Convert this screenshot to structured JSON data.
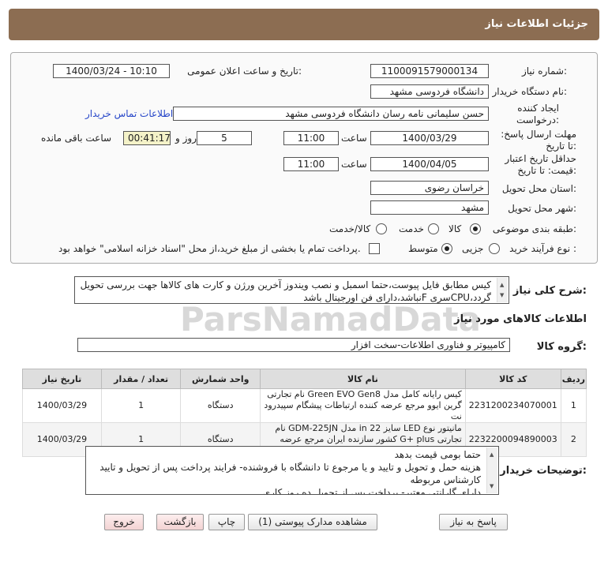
{
  "header": {
    "title": "جزئیات اطلاعات نیاز"
  },
  "form": {
    "need_number_label": "شماره نیاز:",
    "need_number": "1100091579000134",
    "announce_label": "تاریخ و ساعت اعلان عمومی:",
    "announce_value": "1400/03/24 - 10:10",
    "buyer_label": "نام دستگاه خریدار:",
    "buyer_value": "دانشگاه فردوسی مشهد",
    "creator_label": "ایجاد کننده درخواست:",
    "creator_value": "حسن سلیمانی نامه رسان دانشگاه فردوسی مشهد",
    "contact_link": "اطلاعات تماس خریدار",
    "deadline_label": "مهلت ارسال پاسخ: تا تاریخ:",
    "deadline_date": "1400/03/29",
    "time_label": "ساعت",
    "deadline_time": "11:00",
    "days_value": "5",
    "days_label": "روز و",
    "remaining_value": "00:41:17",
    "remaining_label": "ساعت باقی مانده",
    "validity_label": "حداقل تاریخ اعتبار قیمت: تا تاریخ:",
    "validity_date": "1400/04/05",
    "validity_time": "11:00",
    "province_label": "استان محل تحویل:",
    "province_value": "خراسان رضوی",
    "city_label": "شهر محل تحویل:",
    "city_value": "مشهد",
    "category_label": "طبقه بندی موضوعی:",
    "category_options": [
      "کالا",
      "خدمت",
      "کالا/خدمت"
    ],
    "category_selected": "کالا",
    "process_label": "نوع فرآیند خرید :",
    "process_options": [
      "جزیی",
      "متوسط"
    ],
    "process_selected": "متوسط",
    "payment_note": "پرداخت تمام یا بخشی از مبلغ خرید،از محل \"اسناد خزانه اسلامی\" خواهد بود."
  },
  "description": {
    "label": "شرح کلی نیاز:",
    "text": "کیس مطابق فایل پیوست،حتما اسمبل و نصب ویندوز آخرین ورژن و کارت های کالاها جهت بررسی تحویل گردد،CPUسری Fنباشد،دارای فن اورجینال باشد"
  },
  "goods": {
    "section_title": "اطلاعات کالاهای مورد نیاز",
    "group_label": "گروه کالا:",
    "group_value": "کامپیوتر و فناوری اطلاعات-سخت افزار",
    "columns": [
      "ردیف",
      "کد کالا",
      "نام کالا",
      "واحد شمارش",
      "تعداد / مقدار",
      "تاریخ نیاز"
    ],
    "rows": [
      {
        "row": "1",
        "code": "2231200234070001",
        "name": "کیس رایانه کامل مدل Green EVO Gen8 نام تجارتی گرین ایوو مرجع عرضه کننده ارتباطات پیشگام سپیدرود نت",
        "unit": "دستگاه",
        "qty": "1",
        "date": "1400/03/29"
      },
      {
        "row": "2",
        "code": "2232200094890003",
        "name": "مانیتور نوع LED سایز in 22 مدل GDM-225JN نام تجارتی G+ plus کشور سازنده ایران مرجع عرضه کننده صنایع گلدیران",
        "unit": "دستگاه",
        "qty": "1",
        "date": "1400/03/29"
      }
    ]
  },
  "notes": {
    "label": "توضیحات خریدار:",
    "lines": [
      "حتما بومی قیمت بدهد",
      "هزینه حمل و تحویل و تایید و یا مرجوع تا دانشگاه با فروشنده- فرایند پرداخت پس از تحویل و تایید کارشناس مربوطه",
      "دارای گارانتی معتبر- پرداخت پس از تحویل ده روز کاری"
    ]
  },
  "buttons": {
    "reply": "پاسخ به نیاز",
    "attachments": "مشاهده مدارک پیوستی (1)",
    "print": "چاپ",
    "back": "بازگشت",
    "exit": "خروج"
  },
  "watermark": {
    "brand": "ParsNamadData"
  }
}
